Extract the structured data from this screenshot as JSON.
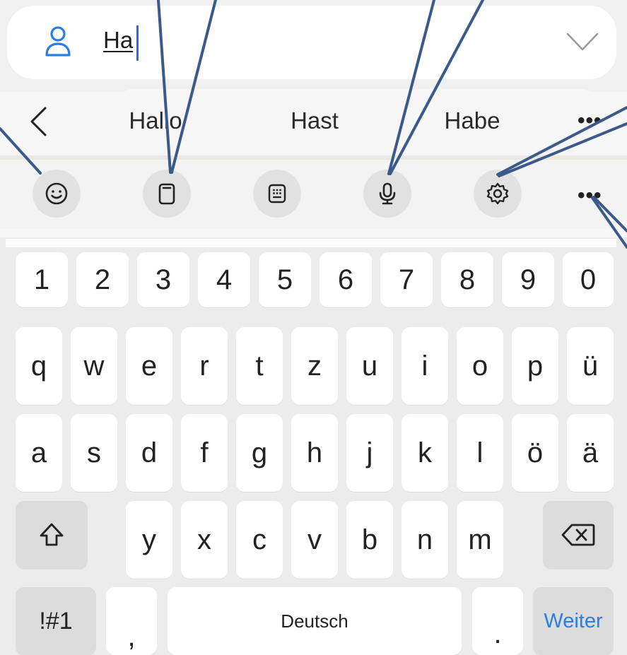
{
  "search": {
    "query": "Ha",
    "icons": {
      "left": "person-icon",
      "right": "chevron-down-icon"
    }
  },
  "suggestions": {
    "items": [
      "Hallo",
      "Hast",
      "Habe"
    ],
    "more": "•••"
  },
  "toolbar": {
    "buttons": [
      "emoji-icon",
      "clipboard-icon",
      "keypad-icon",
      "microphone-icon",
      "settings-icon"
    ],
    "more": "•••"
  },
  "keyboard": {
    "row_numbers": [
      "1",
      "2",
      "3",
      "4",
      "5",
      "6",
      "7",
      "8",
      "9",
      "0"
    ],
    "row_top": [
      "q",
      "w",
      "e",
      "r",
      "t",
      "z",
      "u",
      "i",
      "o",
      "p",
      "ü"
    ],
    "row_home": [
      "a",
      "s",
      "d",
      "f",
      "g",
      "h",
      "j",
      "k",
      "l",
      "ö",
      "ä"
    ],
    "row_bottom": [
      "y",
      "x",
      "c",
      "v",
      "b",
      "n",
      "m"
    ],
    "symbols_label": "!#1",
    "comma": ",",
    "space_label": "Deutsch",
    "period": ".",
    "enter_label": "Weiter"
  },
  "colors": {
    "accent": "#2b7de0",
    "annotation_line": "#3b5a8a",
    "key": "#ffffff",
    "key_dark": "#dcdcdc",
    "background": "#ececec"
  }
}
